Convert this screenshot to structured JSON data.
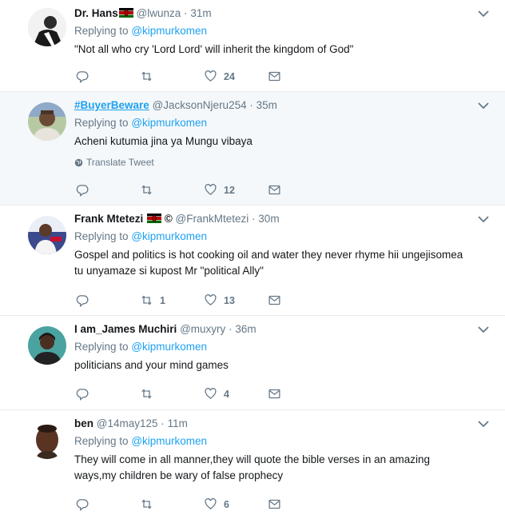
{
  "tweets": [
    {
      "name": "Dr. Hans",
      "handle": "@lwunza",
      "time": "31m",
      "replying_label": "Replying to",
      "replying_to": "@kipmurkomen",
      "text": "\"Not all who cry 'Lord Lord' will inherit the kingdom of God\"",
      "likes": "24",
      "retweets": "",
      "replies": ""
    },
    {
      "name": "#BuyerBeware",
      "handle": "@JacksonNjeru254",
      "time": "35m",
      "replying_label": "Replying to",
      "replying_to": "@kipmurkomen",
      "text": "Acheni kutumia jina ya Mungu vibaya",
      "translate": "Translate Tweet",
      "likes": "12",
      "retweets": "",
      "replies": ""
    },
    {
      "name": "Frank Mtetezi",
      "name_suffix": "©",
      "handle": "@FrankMtetezi",
      "time": "30m",
      "replying_label": "Replying to",
      "replying_to": "@kipmurkomen",
      "text": "Gospel and politics is hot cooking oil and water they never rhyme hii ungejisomea tu unyamaze si kupost Mr \"political Ally\"",
      "likes": "13",
      "retweets": "1",
      "replies": ""
    },
    {
      "name": "I am_James Muchiri",
      "handle": "@muxyry",
      "time": "36m",
      "replying_label": "Replying to",
      "replying_to": "@kipmurkomen",
      "text": "politicians and your mind games",
      "likes": "4",
      "retweets": "",
      "replies": ""
    },
    {
      "name": "ben",
      "handle": "@14may125",
      "time": "11m",
      "replying_label": "Replying to",
      "replying_to": "@kipmurkomen",
      "text": "They will come in all manner,they will quote the bible verses in an amazing ways,my children be wary of false prophecy",
      "likes": "6",
      "retweets": "",
      "replies": ""
    }
  ],
  "icons": [
    "reply-icon",
    "retweet-icon",
    "like-icon",
    "direct-message-icon",
    "caret-down-icon",
    "globe-icon",
    "kenya-flag-icon"
  ],
  "colors": {
    "accent": "#1da1f2",
    "muted": "#657786",
    "text": "#14171a",
    "highlight_bg": "#f5f8fa",
    "divider": "#e6ecf0"
  }
}
